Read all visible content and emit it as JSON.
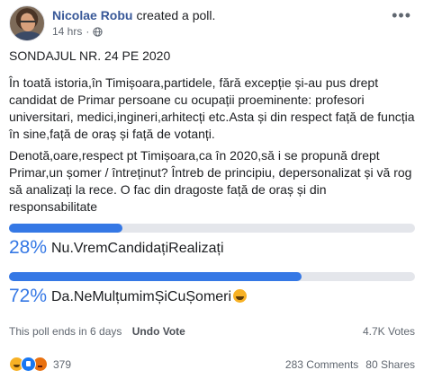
{
  "post": {
    "author": "Nicolae Robu",
    "action": "created a poll.",
    "time": "14 hrs",
    "separator": "·",
    "title": "SONDAJUL NR. 24 PE 2020",
    "paragraph1": "În toată istoria,în Timișoara,partidele, fără excepție și-au pus drept candidat de Primar persoane cu ocupații proeminente: profesori universitari, medici,ingineri,arhitecți etc.Asta și din respect față de funcția în sine,față de oraș și față de votanți.",
    "paragraph2": "Denotă,oare,respect pt Timișoara,ca în 2020,să i se propună drept Primar,un șomer / întreținut? Întreb de principiu, depersonalizat și vă rog să analizați la rece. O fac din dragoste față de oraș și din responsabilitate"
  },
  "poll": {
    "options": [
      {
        "percent_label": "28%",
        "fraction": 0.28,
        "label": "Nu.VremCandidațiRealizați"
      },
      {
        "percent_label": "72%",
        "fraction": 0.72,
        "label": "Da.NeMulțumimȘiCuȘomeri"
      }
    ],
    "ends_text": "This poll ends in 6 days",
    "undo_label": "Undo Vote",
    "votes": "4.7K Votes"
  },
  "engagement": {
    "reaction_count": "379",
    "comments": "283 Comments",
    "shares": "80 Shares"
  },
  "colors": {
    "accent": "#3578e5",
    "author_link": "#385898",
    "bar_track": "#e4e6eb"
  }
}
